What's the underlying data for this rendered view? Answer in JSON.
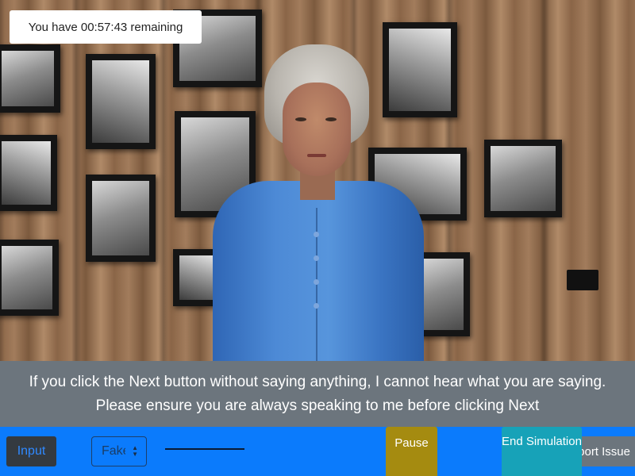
{
  "timer": {
    "text": "You have 00:57:43 remaining"
  },
  "caption": {
    "text": "If you click the Next button without saying anything, I cannot hear what you are saying. Please ensure you are always speaking to me before clicking Next"
  },
  "controls": {
    "input_label": "Input",
    "select_value": "Fake",
    "pause_label": "Pause",
    "end_label": "End Simulation",
    "report_label": "Report Issue"
  },
  "colors": {
    "control_bar": "#0b7bfc",
    "caption_bg": "#6c757d",
    "pause": "#a58b10",
    "end": "#17a2b8"
  }
}
